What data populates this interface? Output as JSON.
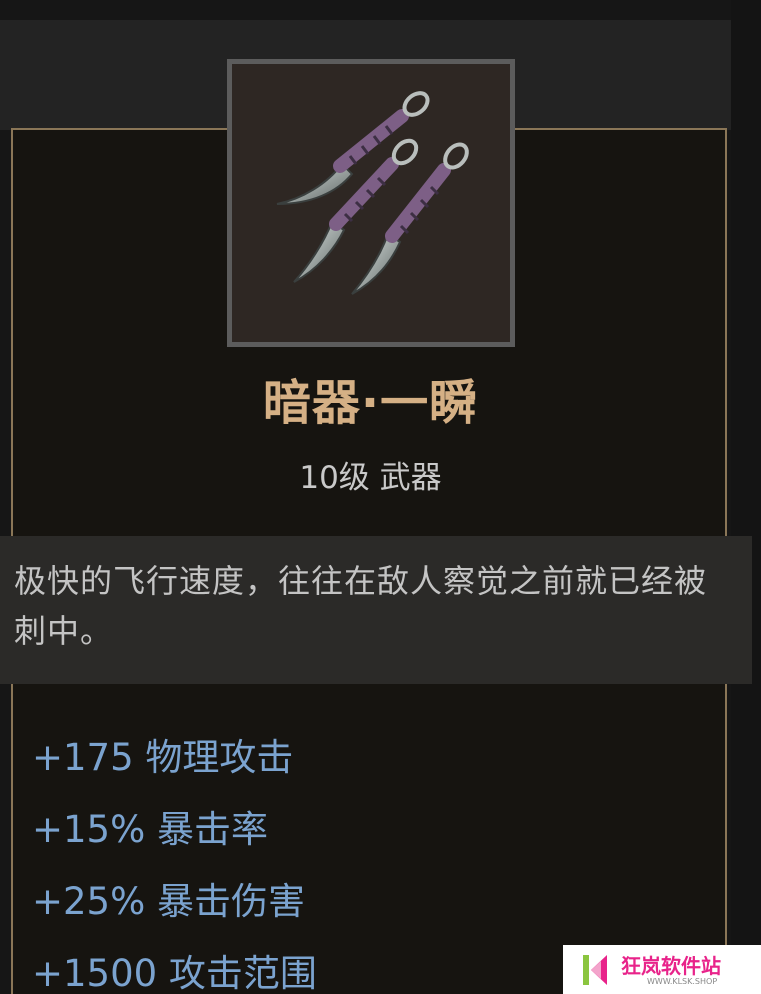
{
  "item": {
    "name": "暗器·一瞬",
    "type_line": "10级 武器",
    "description": "极快的飞行速度，往往在敌人察觉之前就已经被刺中。",
    "icon": "three-throwing-knives-icon"
  },
  "stats": [
    "+175 物理攻击",
    "+15% 暴击率",
    "+25% 暴击伤害",
    "+1500 攻击范围"
  ],
  "watermark": {
    "title": "狂岚软件站",
    "subtitle": "WWW.KLSK.SHOP"
  },
  "colors": {
    "name": "#d5b085",
    "stat": "#7ba3cf",
    "card_border": "#8a7657"
  }
}
